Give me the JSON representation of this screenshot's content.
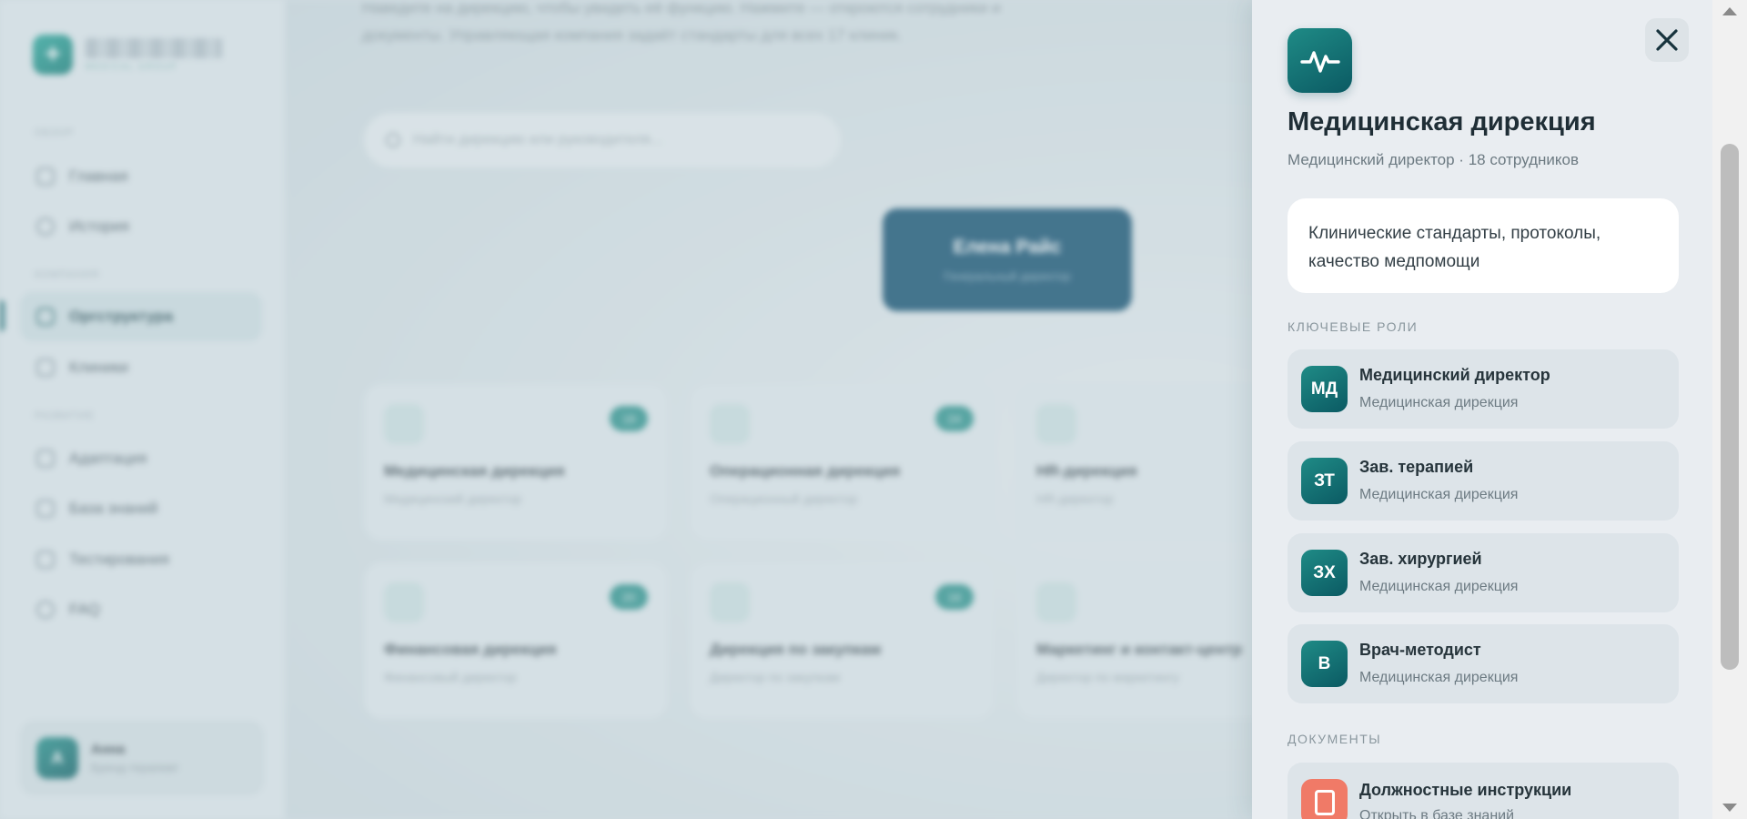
{
  "brand": {
    "subtitle": "MEDICAL GROUP"
  },
  "sidebar": {
    "sections": [
      "ОБЗОР",
      "КОМПАНИЯ",
      "РАЗВИТИЕ"
    ],
    "items": [
      {
        "label": "Главная",
        "icon": "home-icon"
      },
      {
        "label": "История",
        "icon": "clock-icon"
      },
      {
        "label": "Оргструктура",
        "icon": "org-structure-icon",
        "active": true
      },
      {
        "label": "Клиники",
        "icon": "clinic-icon"
      },
      {
        "label": "Адаптация",
        "icon": "trend-icon"
      },
      {
        "label": "База знаний",
        "icon": "book-icon"
      },
      {
        "label": "Тестирования",
        "icon": "test-icon"
      },
      {
        "label": "FAQ",
        "icon": "help-icon"
      }
    ],
    "user": {
      "initial": "А",
      "name": "Анна",
      "role": "Бренд-терапевт"
    }
  },
  "main": {
    "intro": "Наведите на дирекцию, чтобы увидеть её функцию. Нажмите — откроются сотрудники и документы. Управляющая компания задаёт стандарты для всех 17 клиник.",
    "search_placeholder": "Найти дирекцию или руководителя...",
    "ceo": {
      "name": "Елена Райс",
      "role": "Генеральный директор"
    },
    "directorates": [
      {
        "title": "Медицинская дирекция",
        "sub": "Медицинский директор",
        "count": "18",
        "icon": "pulse-icon"
      },
      {
        "title": "Операционная дирекция",
        "sub": "Операционный директор",
        "count": "24",
        "icon": "flow-icon"
      },
      {
        "title": "HR-дирекция",
        "sub": "HR-директор",
        "count": "",
        "icon": "people-icon"
      },
      {
        "title": "Финансовая дирекция",
        "sub": "Финансовый директор",
        "count": "20",
        "icon": "tablet-icon"
      },
      {
        "title": "Дирекция по закупкам",
        "sub": "Директор по закупкам",
        "count": "16",
        "icon": "flow-icon"
      },
      {
        "title": "Маркетинг и контакт-центр",
        "sub": "Директор по маркетингу",
        "count": "",
        "icon": "spark-icon"
      }
    ]
  },
  "drawer": {
    "title": "Медицинская дирекция",
    "meta": "Медицинский директор · 18 сотрудников",
    "description": "Клинические стандарты, протоколы, качество медпомощи",
    "roles_label": "КЛЮЧЕВЫЕ РОЛИ",
    "roles": [
      {
        "initials": "МД",
        "title": "Медицинский директор",
        "sub": "Медицинская дирекция"
      },
      {
        "initials": "ЗТ",
        "title": "Зав. терапией",
        "sub": "Медицинская дирекция"
      },
      {
        "initials": "ЗХ",
        "title": "Зав. хирургией",
        "sub": "Медицинская дирекция"
      },
      {
        "initials": "В",
        "title": "Врач-методист",
        "sub": "Медицинская дирекция"
      }
    ],
    "documents_label": "ДОКУМЕНТЫ",
    "documents": [
      {
        "title": "Должностные инструкции",
        "sub": "Открыть в базе знаний",
        "icon": "document-icon"
      }
    ]
  },
  "colors": {
    "accent": "#0f7c74",
    "ceo": "#0d4c6d",
    "doc": "#f07a67"
  }
}
